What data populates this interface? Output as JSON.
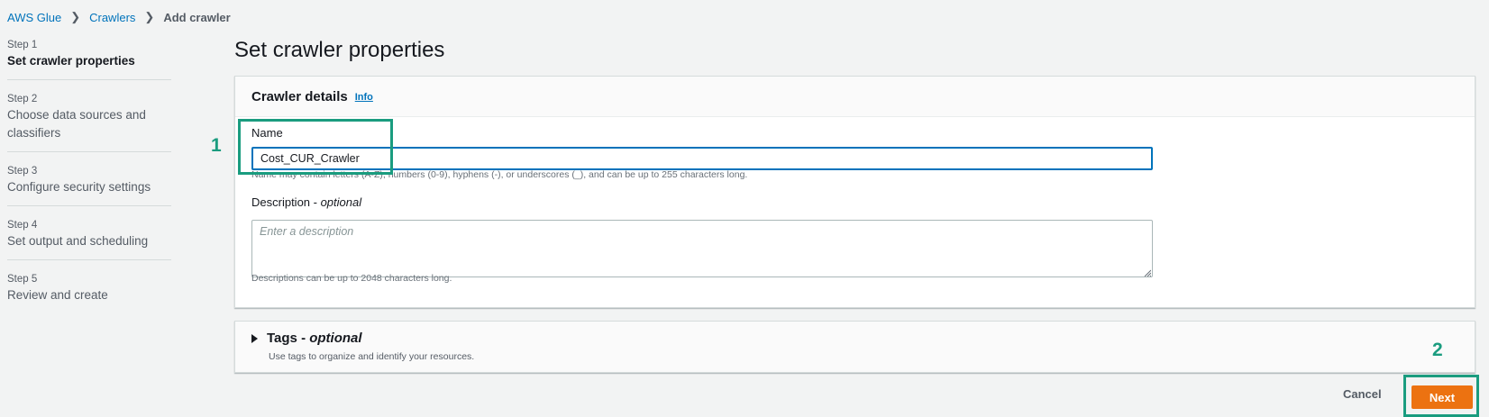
{
  "colors": {
    "accent": "#ec7211",
    "link": "#0073bb",
    "annotation": "#1a9c7f"
  },
  "breadcrumb": {
    "items": [
      "AWS Glue",
      "Crawlers"
    ],
    "current": "Add crawler"
  },
  "steps": [
    {
      "num": "Step 1",
      "label": "Set crawler properties",
      "active": true
    },
    {
      "num": "Step 2",
      "label": "Choose data sources and classifiers"
    },
    {
      "num": "Step 3",
      "label": "Configure security settings"
    },
    {
      "num": "Step 4",
      "label": "Set output and scheduling"
    },
    {
      "num": "Step 5",
      "label": "Review and create"
    }
  ],
  "page_title": "Set crawler properties",
  "details": {
    "title": "Crawler details",
    "info": "Info",
    "name_label": "Name",
    "name_value": "Cost_CUR_Crawler",
    "name_hint": "Name may contain letters (A-Z), numbers (0-9), hyphens (-), or underscores (_), and can be up to 255 characters long.",
    "desc_label": "Description - ",
    "desc_optional": "optional",
    "desc_placeholder": "Enter a description",
    "desc_hint": "Descriptions can be up to 2048 characters long."
  },
  "tags": {
    "title": "Tags - ",
    "optional": "optional",
    "description": "Use tags to organize and identify your resources."
  },
  "footer": {
    "cancel": "Cancel",
    "next": "Next"
  },
  "annotations": {
    "one": "1",
    "two": "2"
  }
}
